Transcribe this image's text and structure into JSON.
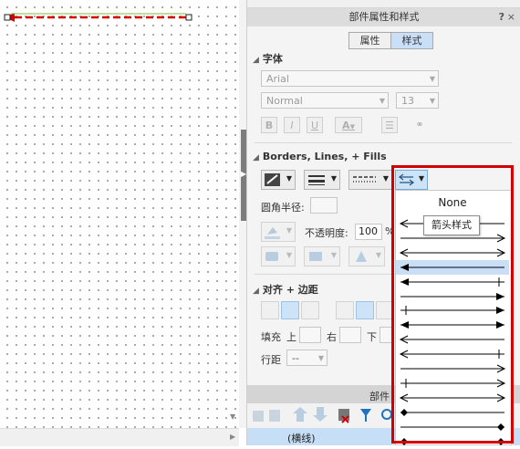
{
  "canvas": {
    "connector": "arrow-connector-selected"
  },
  "panel": {
    "title": "部件属性和样式",
    "help": "?",
    "close": "×",
    "tabs": [
      {
        "label": "属性",
        "active": false
      },
      {
        "label": "样式",
        "active": true
      }
    ]
  },
  "font": {
    "title": "字体",
    "family": "Arial",
    "weight": "Normal",
    "size": "13",
    "bold": "B",
    "italic": "I",
    "underline": "U",
    "text_color": "A"
  },
  "borders": {
    "title": "Borders, Lines, + Fills",
    "corner_radius_label": "圆角半径:",
    "opacity_label": "不透明度:",
    "opacity_value": "100",
    "opacity_unit": "%"
  },
  "align": {
    "title": "对齐 + 边距",
    "padding_label": "填充",
    "top_label": "上",
    "right_label": "右",
    "bottom_label": "下",
    "line_spacing_label": "行距",
    "line_spacing_value": "--"
  },
  "bottom": {
    "title": "部件",
    "row_label": "(横线)"
  },
  "arrow_dropdown": {
    "none_label": "None",
    "tooltip": "箭头样式",
    "options": [
      "arrow-left",
      "arrow-right",
      "arrow-both",
      "arrow-left-filled",
      "arrow-left-filled-bar",
      "arrow-right-filled",
      "arrow-right-filled-bar",
      "arrow-both-filled",
      "arrow-left-open",
      "arrow-left-open-bar",
      "arrow-right-open",
      "arrow-right-open-bar",
      "arrow-both-open",
      "diamond-left",
      "diamond-right",
      "diamond-both"
    ]
  },
  "colors": {
    "highlight": "#d40000",
    "selected_row": "#c8dff7",
    "connector": "#d40000"
  }
}
